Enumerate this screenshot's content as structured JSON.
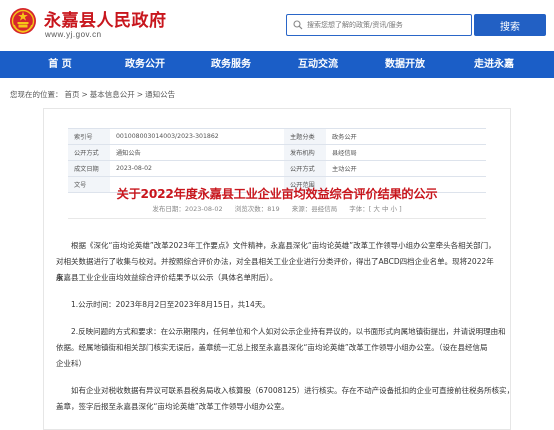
{
  "site": {
    "title": "永嘉县人民政府",
    "url": "www.yj.gov.cn",
    "brand_color": "#c8161d"
  },
  "search": {
    "placeholder": "搜索您想了解的政策/资讯/服务",
    "button": "搜索",
    "accent": "#2260c4"
  },
  "nav": {
    "items": [
      {
        "label": "首 页"
      },
      {
        "label": "政务公开"
      },
      {
        "label": "政务服务"
      },
      {
        "label": "互动交流"
      },
      {
        "label": "数据开放"
      },
      {
        "label": "走进永嘉"
      }
    ]
  },
  "breadcrumb": {
    "prefix": "您现在的位置：",
    "items": [
      "首页",
      "基本信息公开",
      "通知公告"
    ],
    "sep": ">"
  },
  "meta": {
    "rows": [
      {
        "k1": "索引号",
        "v1": "001008003014003/2023-301862",
        "k2": "主题分类",
        "v2": "政务公开"
      },
      {
        "k1": "公开方式",
        "v1": "通知公告",
        "k2": "发布机构",
        "v2": "县经信局"
      },
      {
        "k1": "成文日期",
        "v1": "2023-08-02",
        "k2": "公开方式",
        "v2": "主动公开"
      },
      {
        "k1": "文号",
        "v1": "",
        "k2": "公开范围",
        "v2": ""
      }
    ]
  },
  "article": {
    "title": "关于2022年度永嘉县工业企业亩均效益综合评价结果的公示",
    "date": "发布日期：2023-08-02",
    "views": "浏览次数：819",
    "source": "来源：县经信局",
    "font_size": "字体：[ 大 中 小 ]",
    "p1_line1": "根据《深化“亩均论英雄”改革2023年工作要点》文件精神，永嘉县深化“亩均论英雄”改革工作领导小组办公室牵头各相关部门，",
    "p1_line2": "对相关数据进行了收集与校对。并按照综合评价办法，对全县相关工业企业进行分类评价，得出了ABCD四档企业名单。现将2022年度",
    "p1_line3": "永嘉县工业企业亩均效益综合评价结果予以公示（具体名单附后）。",
    "p2": "1.公示时间：2023年8月2日至2023年8月15日，共14天。",
    "p3_line1": "2.反映问题的方式和要求：在公示期限内，任何单位和个人如对公示企业持有异议的，以书面形式向属地镇街提出，并请说明理由和",
    "p3_line2": "依据。经属地镇街和相关部门核实无误后，盖章统一汇总上报至永嘉县深化“亩均论英雄”改革工作领导小组办公室。（设在县经信局",
    "p3_line3": "企业科）",
    "p4_line1": "如有企业对税收数据有异议可联系县税务局收入核算股（67008125）进行核实。存在不动产设备抵扣的企业可直接前往税务所核实，",
    "p4_line2": "盖章，签字后报至永嘉县深化“亩均论英雄”改革工作领导小组办公室。"
  }
}
